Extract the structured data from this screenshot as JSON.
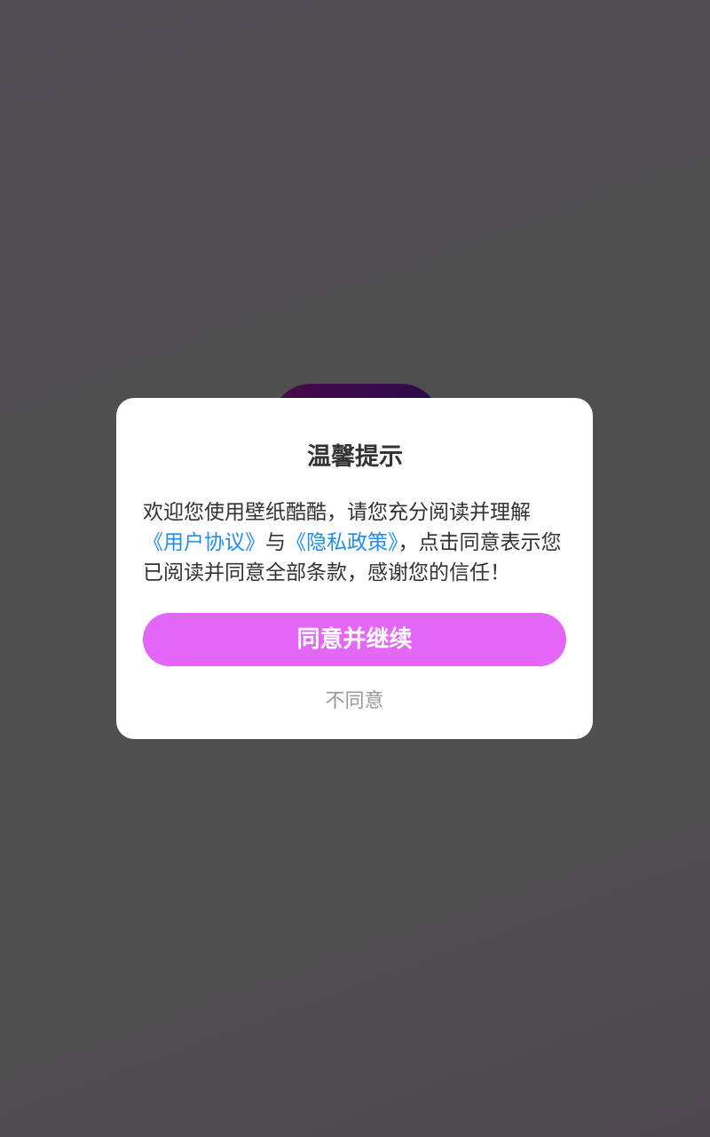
{
  "dialog": {
    "title": "温馨提示",
    "body_prefix": "欢迎您使用壁纸酷酷，请您充分阅读并理解",
    "user_agreement_link": "《用户协议》",
    "connector": "与",
    "privacy_policy_link": "《隐私政策》",
    "body_suffix": "，点击同意表示您已阅读并同意全部条款，感谢您的信任！",
    "agree_label": "同意并继续",
    "disagree_label": "不同意"
  },
  "colors": {
    "accent": "#e467fa",
    "link": "#1f8ef0",
    "overlay": "#4f4f4f"
  }
}
